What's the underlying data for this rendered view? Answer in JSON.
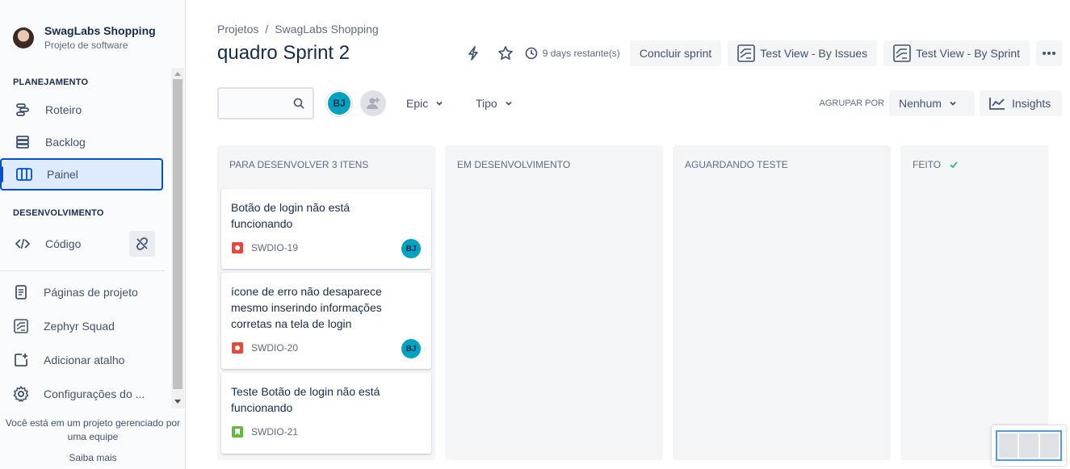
{
  "sidebar": {
    "project_name": "SwagLabs Shopping",
    "project_type": "Projeto de software",
    "planning_title": "PLANEJAMENTO",
    "planning_items": [
      {
        "label": "Roteiro",
        "icon": "roadmap-icon"
      },
      {
        "label": "Backlog",
        "icon": "backlog-icon"
      },
      {
        "label": "Painel",
        "icon": "board-icon"
      }
    ],
    "dev_title": "DESENVOLVIMENTO",
    "dev_items": [
      {
        "label": "Código",
        "icon": "code-icon"
      }
    ],
    "other_items": [
      {
        "label": "Páginas de projeto",
        "icon": "page-icon"
      },
      {
        "label": "Zephyr Squad",
        "icon": "zephyr-icon"
      },
      {
        "label": "Adicionar atalho",
        "icon": "add-shortcut-icon"
      },
      {
        "label": "Configurações do ...",
        "icon": "gear-icon"
      }
    ],
    "footer_text": "Você está em um projeto gerenciado por uma equipe",
    "learn_more": "Saiba mais"
  },
  "header": {
    "breadcrumb": [
      "Projetos",
      "SwagLabs Shopping"
    ],
    "breadcrumb_sep": "/",
    "title": "quadro Sprint 2",
    "remaining": "9 days restante(s)",
    "complete_sprint": "Concluir sprint",
    "test_view_issues": "Test View - By Issues",
    "test_view_sprint": "Test View - By Sprint"
  },
  "toolbar": {
    "avatar_initials": "BJ",
    "epic_label": "Epic",
    "type_label": "Tipo",
    "group_by_label": "AGRUPAR POR",
    "group_by_value": "Nenhum",
    "insights_label": "Insights"
  },
  "board": {
    "columns": [
      {
        "title": "PARA DESENVOLVER 3 ITENS"
      },
      {
        "title": "EM DESENVOLVIMENTO"
      },
      {
        "title": "AGUARDANDO TESTE"
      },
      {
        "title": "FEITO"
      }
    ],
    "cards": [
      {
        "summary": "Botão de login não está funcionando",
        "key": "SWDIO-19",
        "type": "bug",
        "assignee": "BJ"
      },
      {
        "summary": "ícone de erro não desaparece mesmo inserindo informações corretas na tela de login",
        "key": "SWDIO-20",
        "type": "bug",
        "assignee": "BJ"
      },
      {
        "summary": "Teste Botão de login não está funcionando",
        "key": "SWDIO-21",
        "type": "story",
        "assignee": ""
      }
    ]
  },
  "colors": {
    "accent": "#0052cc",
    "bug": "#e5493a",
    "story": "#63ba3c",
    "avatar": "#00a3bf",
    "done_check": "#36b37e"
  }
}
